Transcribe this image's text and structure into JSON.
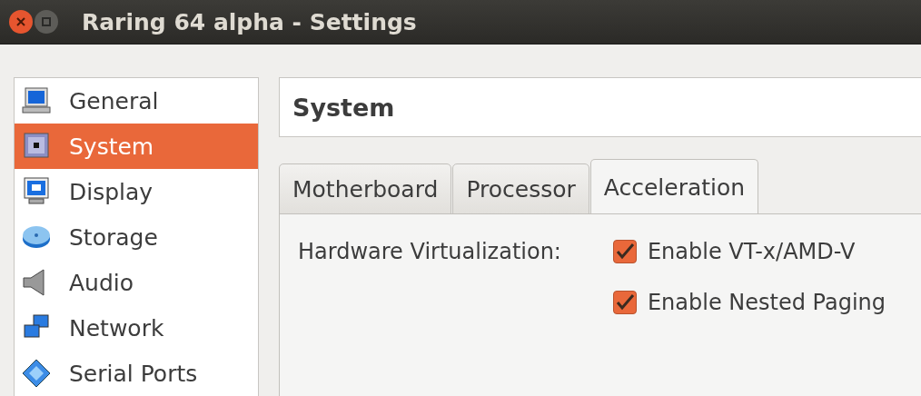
{
  "window": {
    "title": "Raring 64 alpha - Settings"
  },
  "sidebar": {
    "items": [
      {
        "label": "General",
        "selected": false
      },
      {
        "label": "System",
        "selected": true
      },
      {
        "label": "Display",
        "selected": false
      },
      {
        "label": "Storage",
        "selected": false
      },
      {
        "label": "Audio",
        "selected": false
      },
      {
        "label": "Network",
        "selected": false
      },
      {
        "label": "Serial Ports",
        "selected": false
      }
    ]
  },
  "header": {
    "title": "System"
  },
  "tabs": [
    {
      "label": "Motherboard",
      "selected": false
    },
    {
      "label": "Processor",
      "selected": false
    },
    {
      "label": "Acceleration",
      "selected": true
    }
  ],
  "acceleration": {
    "label": "Hardware Virtualization:",
    "options": [
      {
        "label": "Enable VT-x/AMD-V",
        "checked": true
      },
      {
        "label": "Enable Nested Paging",
        "checked": true
      }
    ]
  }
}
